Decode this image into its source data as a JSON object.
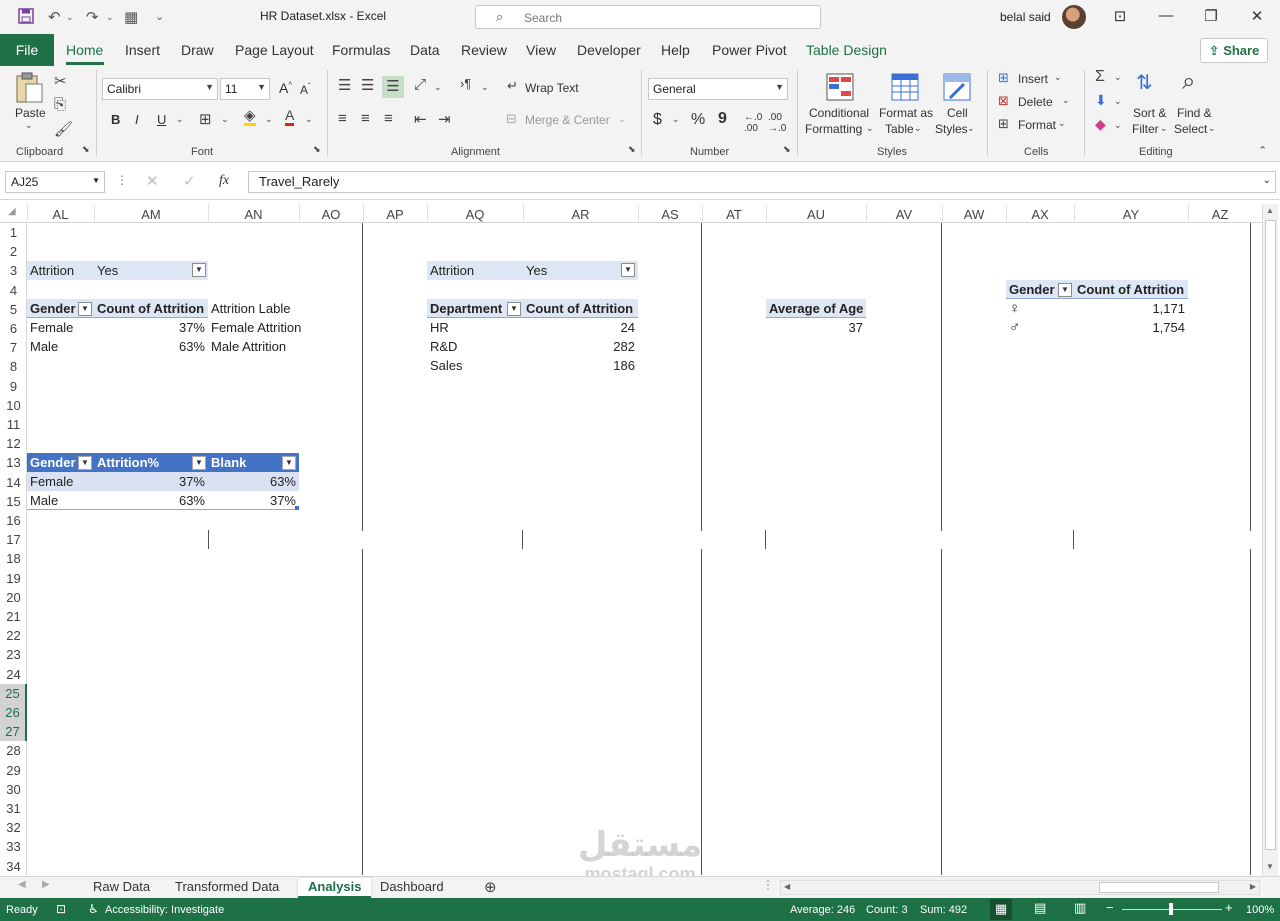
{
  "titlebar": {
    "doc_title": "HR Dataset.xlsx  -  Excel",
    "search_placeholder": "Search",
    "user_name": "belal said"
  },
  "menu": {
    "file": "File",
    "items": [
      "Home",
      "Insert",
      "Draw",
      "Page Layout",
      "Formulas",
      "Data",
      "Review",
      "View",
      "Developer",
      "Help",
      "Power Pivot",
      "Table Design"
    ],
    "active": "Home",
    "share": "Share"
  },
  "ribbon": {
    "clipboard": {
      "paste": "Paste",
      "label": "Clipboard"
    },
    "font": {
      "name": "Calibri",
      "size": "11",
      "bold": "B",
      "italic": "I",
      "underline": "U",
      "label": "Font"
    },
    "alignment": {
      "wrap_text": "Wrap Text",
      "merge_center": "Merge & Center",
      "label": "Alignment"
    },
    "number": {
      "format": "General",
      "currency": "$",
      "percent": "%",
      "comma": "9",
      "label": "Number"
    },
    "styles": {
      "conditional_line1": "Conditional",
      "conditional_line2": "Formatting",
      "format_table_line1": "Format as",
      "format_table_line2": "Table",
      "cell_styles_line1": "Cell",
      "cell_styles_line2": "Styles",
      "label": "Styles"
    },
    "cells": {
      "insert": "Insert",
      "delete": "Delete",
      "format": "Format",
      "label": "Cells"
    },
    "editing": {
      "sort_line1": "Sort &",
      "sort_line2": "Filter",
      "find_line1": "Find &",
      "find_line2": "Select",
      "label": "Editing"
    }
  },
  "formula_bar": {
    "name_box": "AJ25",
    "fx": "fx",
    "value": "Travel_Rarely"
  },
  "columns": [
    "AL",
    "AM",
    "AN",
    "AO",
    "AP",
    "AQ",
    "AR",
    "AS",
    "AT",
    "AU",
    "AV",
    "AW",
    "AX",
    "AY",
    "AZ"
  ],
  "rows": [
    "1",
    "2",
    "3",
    "4",
    "5",
    "6",
    "7",
    "8",
    "9",
    "10",
    "11",
    "12",
    "13",
    "14",
    "15",
    "16",
    "17",
    "18",
    "19",
    "20",
    "21",
    "22",
    "23",
    "24",
    "25",
    "26",
    "27",
    "28",
    "29",
    "30",
    "31",
    "32",
    "33",
    "34"
  ],
  "selected_rows": [
    "25",
    "26",
    "27"
  ],
  "pivot1": {
    "filter_field": "Attrition",
    "filter_value": "Yes",
    "header_row": "Gender",
    "header_value": "Count of Attrition",
    "extra_header": "Attrition Lable",
    "rows": [
      {
        "label": "Female",
        "value": "37%",
        "extra": "Female Attrition"
      },
      {
        "label": "Male",
        "value": "63%",
        "extra": "Male Attrition"
      }
    ]
  },
  "table1": {
    "headers": [
      "Gender",
      "Attrition%",
      "Blank"
    ],
    "rows": [
      [
        "Female",
        "37%",
        "63%"
      ],
      [
        "Male",
        "63%",
        "37%"
      ]
    ]
  },
  "pivot2": {
    "filter_field": "Attrition",
    "filter_value": "Yes",
    "header_row": "Department",
    "header_value": "Count of Attrition",
    "rows": [
      {
        "label": "HR",
        "value": "24"
      },
      {
        "label": "R&D",
        "value": "282"
      },
      {
        "label": "Sales",
        "value": "186"
      }
    ]
  },
  "pivot3": {
    "header": "Average of Age",
    "value": "37"
  },
  "pivot4": {
    "header_row": "Gender",
    "header_value": "Count of Attrition",
    "rows": [
      {
        "icon": "female-symbol",
        "glyph": "♀",
        "value": "1,171"
      },
      {
        "icon": "male-symbol",
        "glyph": "♂",
        "value": "1,754"
      }
    ]
  },
  "sheet_tabs": [
    "Raw Data",
    "Transformed Data",
    "Analysis",
    "Dashboard"
  ],
  "active_sheet": "Analysis",
  "status": {
    "ready": "Ready",
    "accessibility": "Accessibility: Investigate",
    "average": "Average: 246",
    "count": "Count: 3",
    "sum": "Sum: 492",
    "zoom": "100%"
  },
  "colors": {
    "excel_green": "#1e7145",
    "table_header": "#4472c4",
    "table_band": "#d9e1f2",
    "pivot_header": "#dce6f4"
  },
  "watermark": {
    "arabic": "مستقل",
    "latin": "mostaql.com"
  }
}
